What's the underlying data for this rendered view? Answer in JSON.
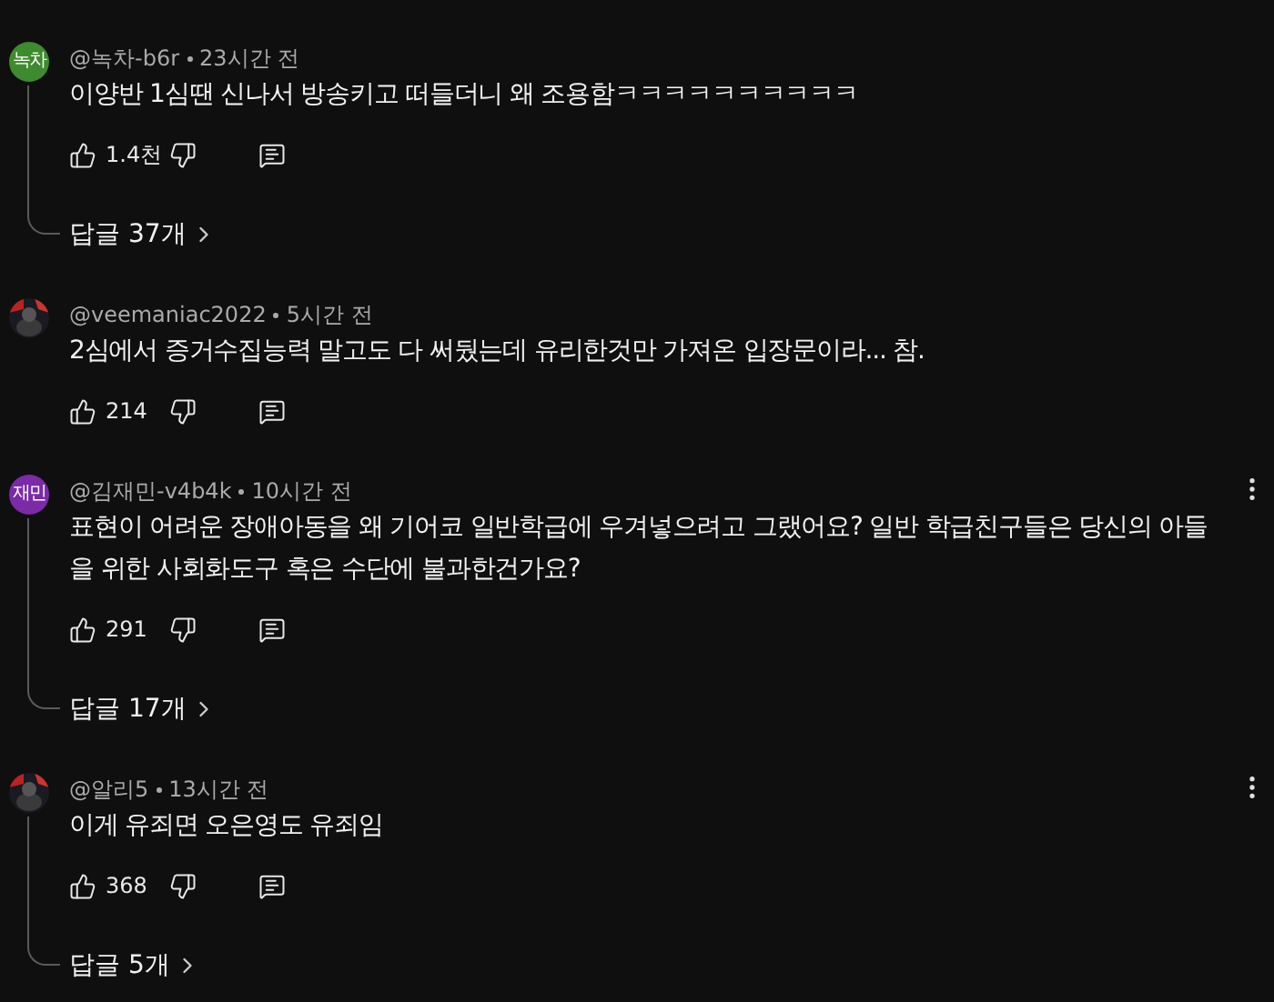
{
  "comments": [
    {
      "avatar": {
        "kind": "initials",
        "text": "녹차",
        "color": "#3e8b2f"
      },
      "author": "@녹차-b6r",
      "time": "23시간 전",
      "text": "이양반 1심땐 신나서 방송키고 떠들더니 왜 조용함ㅋㅋㅋㅋㅋㅋㅋㅋㅋㅋ",
      "likes": "1.4천",
      "menu": false,
      "replies": "답글 37개"
    },
    {
      "author": "@veemaniac2022",
      "time": "5시간 전",
      "text": "2심에서 증거수집능력 말고도 다 써뒀는데 유리한것만 가져온 입장문이라... 참.",
      "likes": "214",
      "menu": false
    },
    {
      "avatar": {
        "kind": "initials",
        "text": "재민",
        "color": "#7b2aa8"
      },
      "author": "@김재민-v4b4k",
      "time": "10시간 전",
      "text": "표현이 어려운 장애아동을 왜 기어코 일반학급에 우겨넣으려고 그랬어요? 일반 학급친구들은 당신의 아들을 위한 사회화도구 혹은 수단에 불과한건가요?",
      "likes": "291",
      "menu": true,
      "replies": "답글 17개"
    },
    {
      "author": "@알리5",
      "time": "13시간 전",
      "text": "이게 유죄면 오은영도 유죄임",
      "likes": "368",
      "menu": true,
      "replies": "답글 5개"
    }
  ]
}
